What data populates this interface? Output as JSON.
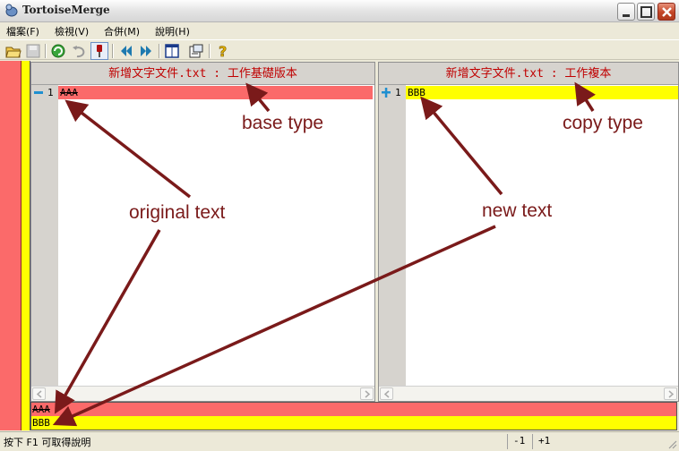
{
  "window": {
    "title": "TortoiseMerge"
  },
  "menu": [
    {
      "label": "檔案(F)"
    },
    {
      "label": "檢視(V)"
    },
    {
      "label": "合併(M)"
    },
    {
      "label": "說明(H)"
    }
  ],
  "toolbar_icons": [
    "open-icon",
    "save-icon",
    "refresh-icon",
    "undo-icon",
    "pin-icon",
    "prev-diff-icon",
    "next-diff-icon",
    "layout-icon",
    "settings-icon",
    "help-icon"
  ],
  "left_pane": {
    "header": "新增文字文件.txt : 工作基礎版本",
    "lines": [
      {
        "number": "1",
        "text": "AAA",
        "marker": "minus-icon"
      }
    ]
  },
  "right_pane": {
    "header": "新增文字文件.txt : 工作複本",
    "lines": [
      {
        "number": "1",
        "text": "BBB",
        "marker": "plus-icon"
      }
    ]
  },
  "bottom_panel": {
    "line1": "AAA",
    "line2": "BBB"
  },
  "status": {
    "hint": "按下 F1 可取得說明",
    "left_count": "-1",
    "right_count": "+1"
  },
  "annotations": {
    "base_type": "base type",
    "copy_type": "copy type",
    "original_text": "original text",
    "new_text": "new text"
  },
  "colors": {
    "removed": "#fb6a6a",
    "added": "#ffff00",
    "annotation": "#7a1a1a",
    "header_text": "#c00000"
  }
}
